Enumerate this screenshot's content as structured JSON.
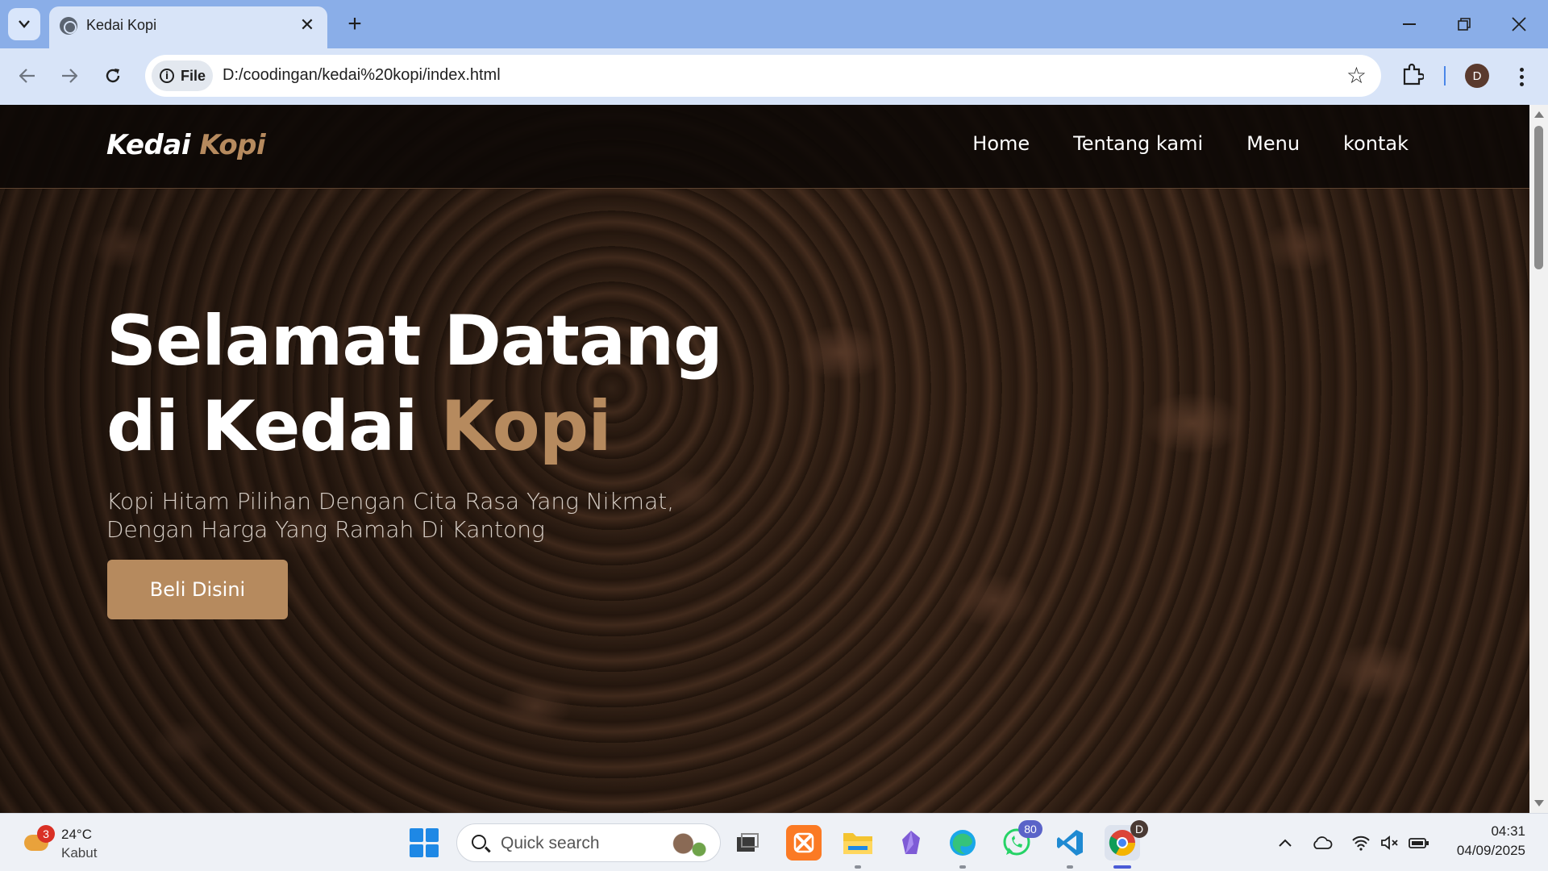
{
  "browser": {
    "tab": {
      "title": "Kedai Kopi"
    },
    "omnibox": {
      "chip": "File",
      "url": "D:/coodingan/kedai%20kopi/index.html"
    },
    "profile_initial": "D"
  },
  "page": {
    "brand": {
      "name": "Kedai",
      "accent": "Kopi"
    },
    "nav": [
      "Home",
      "Tentang kami",
      "Menu",
      "kontak"
    ],
    "hero": {
      "title_line1": "Selamat Datang",
      "title_line2_prefix": "di Kedai ",
      "title_line2_accent": "Kopi",
      "subtitle": "Kopi Hitam Pilihan Dengan Cita Rasa Yang Nikmat, Dengan Harga Yang Ramah Di Kantong",
      "cta": "Beli Disini"
    },
    "colors": {
      "accent": "#b68a5e",
      "nav_bg": "#0c0806"
    }
  },
  "taskbar": {
    "weather": {
      "badge": "3",
      "temp": "24°C",
      "desc": "Kabut"
    },
    "search_placeholder": "Quick search",
    "apps": [
      {
        "name": "task-view",
        "badge": ""
      },
      {
        "name": "xampp",
        "badge": ""
      },
      {
        "name": "file-explorer",
        "badge": ""
      },
      {
        "name": "obsidian",
        "badge": ""
      },
      {
        "name": "edge",
        "badge": ""
      },
      {
        "name": "whatsapp",
        "badge": "80"
      },
      {
        "name": "vscode",
        "badge": ""
      },
      {
        "name": "chrome",
        "badge": "D"
      }
    ],
    "clock": {
      "time": "04:31",
      "date": "04/09/2025"
    }
  }
}
